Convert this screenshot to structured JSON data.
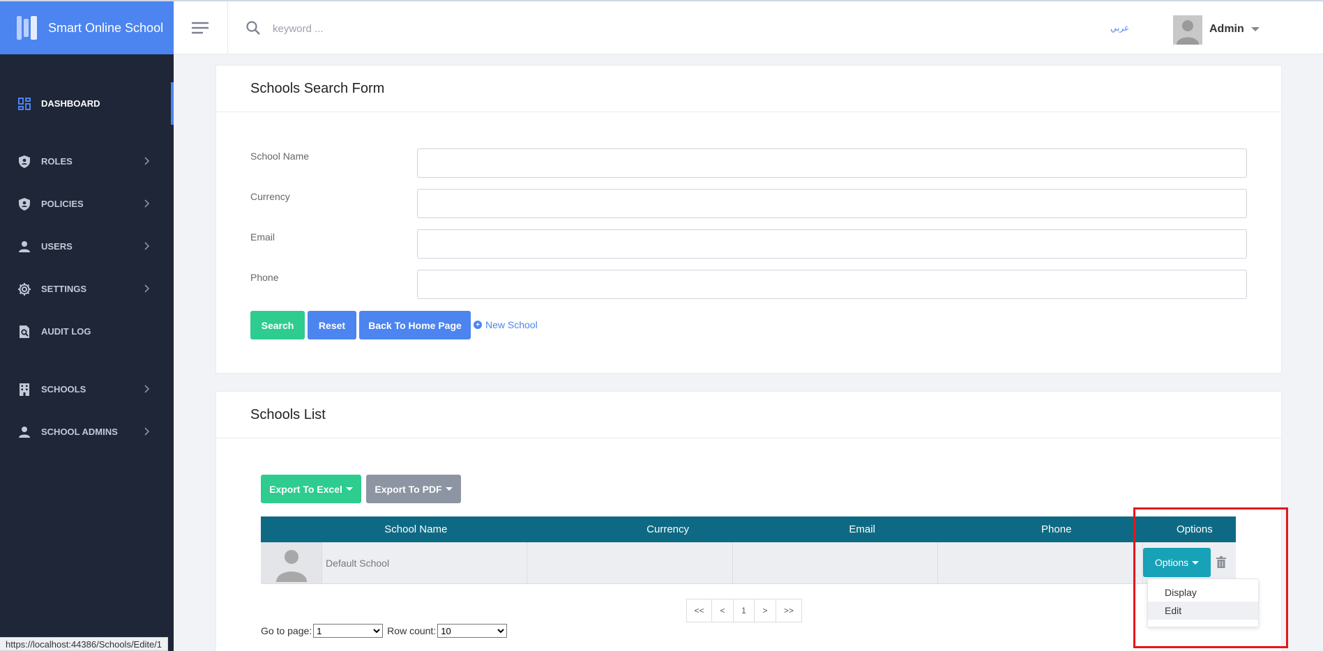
{
  "app": {
    "title": "Smart Online School"
  },
  "topbar": {
    "search_placeholder": "keyword ...",
    "language": "عربي",
    "user_name": "Admin"
  },
  "sidebar": {
    "items": [
      {
        "label": "DASHBOARD",
        "icon": "dashboard-icon",
        "active": true
      },
      {
        "label": "ROLES",
        "icon": "shield-icon"
      },
      {
        "label": "POLICIES",
        "icon": "shield-icon"
      },
      {
        "label": "USERS",
        "icon": "user-icon"
      },
      {
        "label": "SETTINGS",
        "icon": "gear-icon"
      },
      {
        "label": "AUDIT LOG",
        "icon": "audit-icon"
      },
      {
        "label": "SCHOOLS",
        "icon": "building-icon"
      },
      {
        "label": "SCHOOL ADMINS",
        "icon": "user-icon"
      }
    ]
  },
  "search_form": {
    "title": "Schools Search Form",
    "fields": [
      {
        "label": "School Name",
        "value": ""
      },
      {
        "label": "Currency",
        "value": ""
      },
      {
        "label": "Email",
        "value": ""
      },
      {
        "label": "Phone",
        "value": ""
      }
    ],
    "buttons": {
      "search": "Search",
      "reset": "Reset",
      "back": "Back To Home Page",
      "new_school": "New School"
    }
  },
  "schools_list": {
    "title": "Schools List",
    "export_excel": "Export To Excel",
    "export_pdf": "Export To PDF",
    "columns": [
      "School Name",
      "Currency",
      "Email",
      "Phone",
      "Options"
    ],
    "rows": [
      {
        "school_name": "Default School",
        "currency": "",
        "email": "",
        "phone": "",
        "options_label": "Options"
      }
    ],
    "dropdown": [
      "Display",
      "Edit"
    ],
    "pager": [
      "<<",
      "<",
      "1",
      ">",
      ">>"
    ],
    "goto_label": "Go to page:",
    "goto_value": "1",
    "row_count_label": "Row count:",
    "row_count_value": "10"
  },
  "status_url": "https://localhost:44386/Schools/Edite/1"
}
